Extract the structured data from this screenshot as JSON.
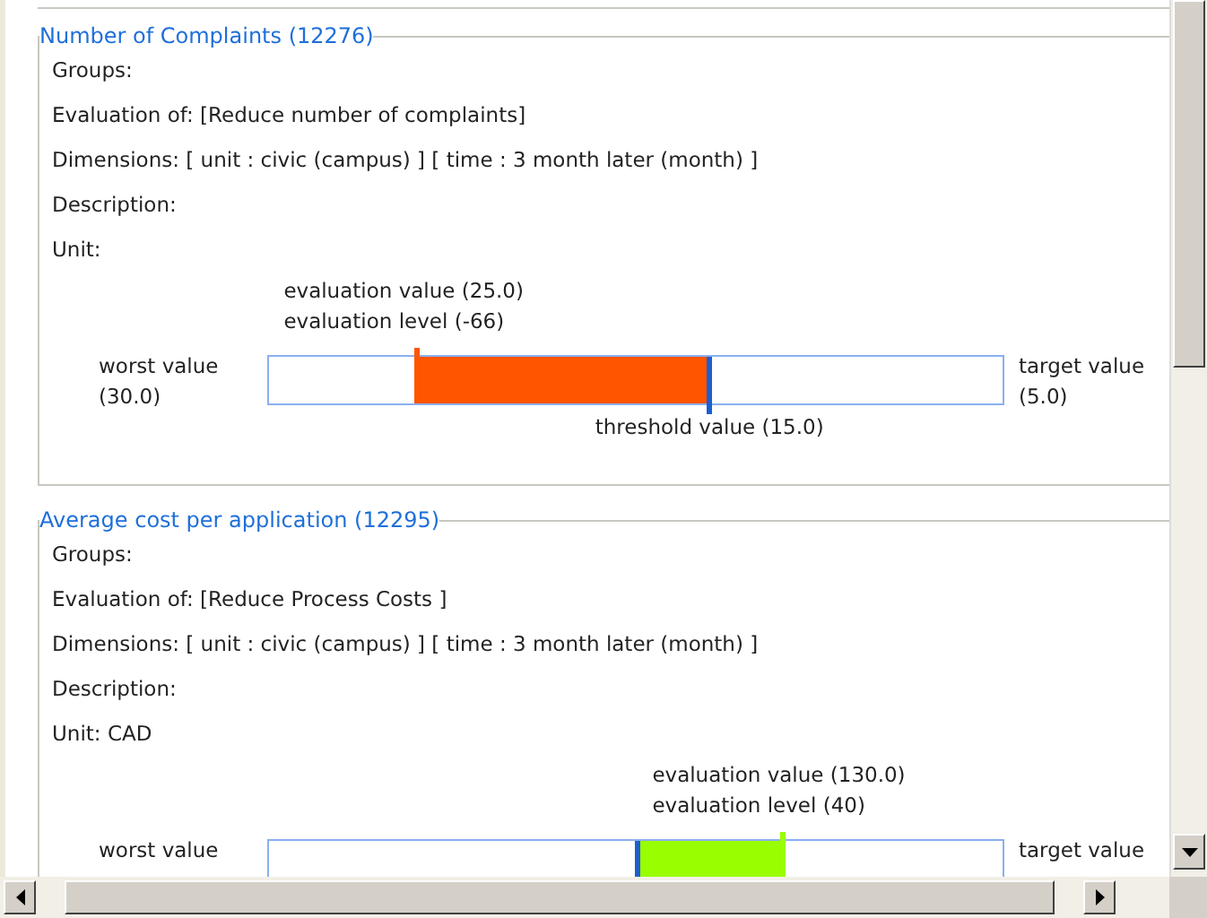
{
  "panels": [
    {
      "title": "Number of Complaints (12276)",
      "fields": [
        {
          "text": "Groups:"
        },
        {
          "text": "Evaluation of: [Reduce number of complaints]"
        },
        {
          "text": "Dimensions: [ unit : civic (campus) ]  [ time : 3 month later (month) ]"
        },
        {
          "text": "Description:"
        },
        {
          "text": "Unit:"
        }
      ],
      "gauge": {
        "evaluation_value": "evaluation value (25.0)",
        "evaluation_level": "evaluation level (-66)",
        "worst_label": "worst value",
        "worst_value": "(30.0)",
        "target_label": "target value",
        "target_value": "(5.0)",
        "threshold_text": "threshold value (15.0)",
        "evaluation": {
          "level": 0.2
        },
        "threshold": {
          "level": 0.6
        },
        "color": "#ff5500"
      }
    },
    {
      "title": "Average cost per application (12295)",
      "fields": [
        {
          "text": "Groups:"
        },
        {
          "text": "Evaluation of: [Reduce Process Costs ]"
        },
        {
          "text": "Dimensions: [ unit : civic (campus) ]  [ time : 3 month later (month) ]"
        },
        {
          "text": "Description:"
        },
        {
          "text": "Unit: CAD"
        }
      ],
      "gauge": {
        "evaluation_value": "evaluation value (130.0)",
        "evaluation_level": "evaluation level (40)",
        "worst_label": "worst value",
        "target_label": "target value",
        "evaluation": {
          "level": 0.7
        },
        "threshold": {
          "level": 0.5
        },
        "color": "#99ff00"
      }
    }
  ]
}
